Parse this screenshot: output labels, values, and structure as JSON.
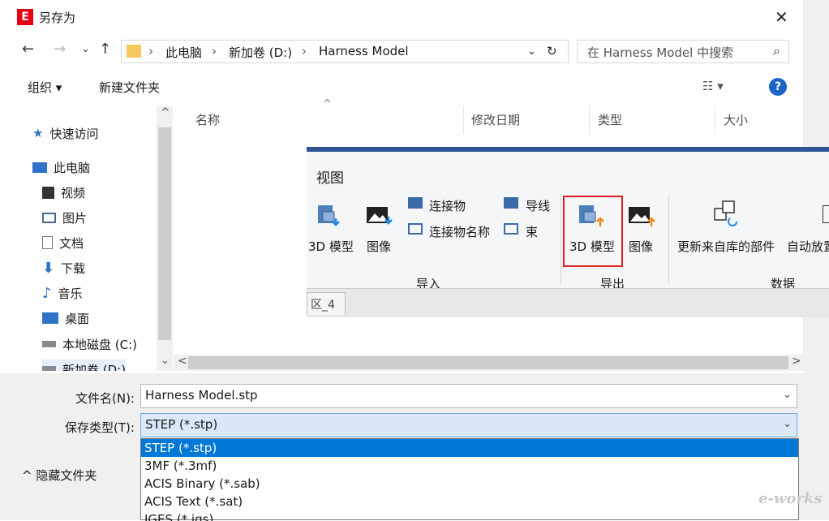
{
  "window": {
    "title": "另存为",
    "close_glyph": "✕",
    "app_icon_glyph": "E"
  },
  "nav": {
    "back": "←",
    "forward": "→",
    "recent": "⌄",
    "up": "↑",
    "breadcrumb": [
      "此电脑",
      "新加卷 (D:)",
      "Harness Model"
    ],
    "sep": "›",
    "addr_dropdown": "⌄",
    "refresh": "↻",
    "search_placeholder": "在 Harness Model 中搜索",
    "search_glyph": "⌕"
  },
  "toolbar": {
    "organize": "组织 ▾",
    "new_folder": "新建文件夹",
    "view_glyph": "☷ ▾",
    "help": "?"
  },
  "sidebar": {
    "items": [
      {
        "label": "快速访问",
        "icon": "star-icon",
        "color": "#2e73c8"
      },
      {
        "label": "此电脑",
        "icon": "computer-icon",
        "color": "#2e73c8"
      },
      {
        "label": "视频",
        "icon": "video-icon",
        "color": "#333333"
      },
      {
        "label": "图片",
        "icon": "pictures-icon",
        "color": "#4a6a8a"
      },
      {
        "label": "文档",
        "icon": "documents-icon",
        "color": "#6a6a6a"
      },
      {
        "label": "下载",
        "icon": "download-icon",
        "color": "#2e73c8"
      },
      {
        "label": "音乐",
        "icon": "music-icon",
        "color": "#2e73c8"
      },
      {
        "label": "桌面",
        "icon": "desktop-icon",
        "color": "#2e73c8"
      },
      {
        "label": "本地磁盘 (C:)",
        "icon": "drive-icon",
        "color": "#6a6a6a"
      },
      {
        "label": "新加卷 (D:)",
        "icon": "drive-icon",
        "color": "#6a6a6a"
      }
    ],
    "scroll_up": "^",
    "scroll_down": "⌄"
  },
  "columns": {
    "name": "名称",
    "modified": "修改日期",
    "type": "类型",
    "size": "大小",
    "sort_glyph": "^"
  },
  "hscroll": {
    "left": "<",
    "right": ">"
  },
  "form": {
    "filename_label": "文件名(N):",
    "filename_value": "Harness Model.stp",
    "filetype_label": "保存类型(T):",
    "filetype_value": "STEP (*.stp)",
    "dropdown_glyph": "⌄",
    "hide_folders": "^ 隐藏文件夹"
  },
  "filetype_options": [
    "STEP (*.stp)",
    "3MF (*.3mf)",
    "ACIS Binary (*.sab)",
    "ACIS Text (*.sat)",
    "IGES (*.igs)"
  ],
  "ribbon": {
    "tab": "视图",
    "import_3d": "3D 模型",
    "import_image": "图像",
    "connector": "连接物",
    "connector_name": "连接物名称",
    "wire": "导线",
    "bundle": "束",
    "export_3d": "3D 模型",
    "export_image": "图像",
    "update_parts": "更新来自库的部件",
    "auto_place": "自动放置",
    "group_import": "导入",
    "group_export": "导出",
    "group_data": "数据",
    "doc_tab": "区_4"
  },
  "watermark": "e-works",
  "colors": {
    "accent": "#0078d7",
    "ribbon_bar": "#2d5496",
    "highlight": "#e02020",
    "brand": "#e60012"
  }
}
